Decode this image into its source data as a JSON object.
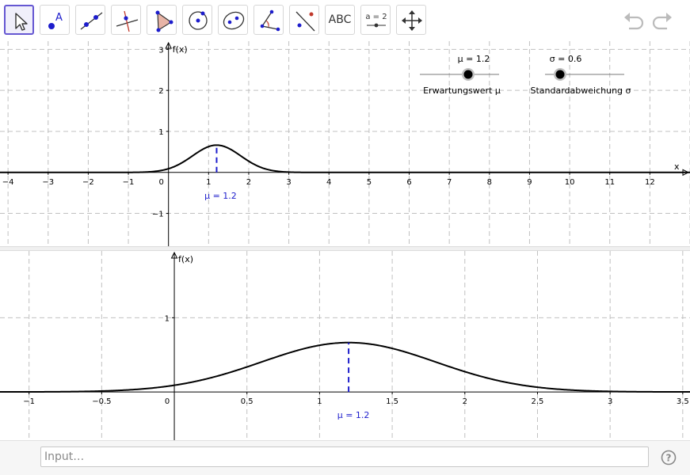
{
  "toolbar": {
    "tools": [
      {
        "name": "move-tool",
        "icon": "cursor-arrow-icon",
        "selected": true
      },
      {
        "name": "point-tool",
        "icon": "point-with-label-icon"
      },
      {
        "name": "line-tool",
        "icon": "line-through-two-points-icon"
      },
      {
        "name": "perpendicular-tool",
        "icon": "perpendicular-line-icon"
      },
      {
        "name": "polygon-tool",
        "icon": "polygon-icon"
      },
      {
        "name": "circle-tool",
        "icon": "circle-with-center-icon"
      },
      {
        "name": "conic-tool",
        "icon": "ellipse-icon"
      },
      {
        "name": "angle-tool",
        "icon": "angle-icon"
      },
      {
        "name": "reflect-tool",
        "icon": "reflect-about-line-icon"
      },
      {
        "name": "text-tool",
        "icon": "text-icon",
        "label": "ABC"
      },
      {
        "name": "slider-tool",
        "icon": "slider-icon",
        "label": "a = 2"
      },
      {
        "name": "move-graphics-view-tool",
        "icon": "move-arrows-icon"
      }
    ],
    "undo_icon": "undo-icon",
    "redo_icon": "redo-icon"
  },
  "colors": {
    "grid": "#c0c0c0",
    "axis": "#000000",
    "curve": "#000000",
    "mean_line": "#1d1dcc",
    "slider_line": "#7a7a7a",
    "slider_knob": "#000000",
    "selection": "#6557d2"
  },
  "graphics1": {
    "x_label": "x",
    "y_label": "f(x)",
    "x_ticks": [
      "−4",
      "−3",
      "−2",
      "−1",
      "0",
      "1",
      "2",
      "3",
      "4",
      "5",
      "6",
      "7",
      "8",
      "9",
      "10",
      "11",
      "12"
    ],
    "y_ticks": [
      "3",
      "2",
      "1",
      "−1"
    ],
    "mean_label": "μ = 1.2"
  },
  "graphics2": {
    "y_label": "f(x)",
    "x_ticks": [
      "−1",
      "−0.5",
      "0",
      "0.5",
      "1",
      "1.5",
      "2",
      "2.5",
      "3",
      "3.5"
    ],
    "y_ticks": [
      "1"
    ],
    "mean_label": "μ = 1.2"
  },
  "sliders": [
    {
      "name": "mu-slider",
      "value_label": "μ = 1.2",
      "caption": "Erwartungswert μ",
      "value": 1.2
    },
    {
      "name": "sigma-slider",
      "value_label": "σ = 0.6",
      "caption": "Standardabweichung σ",
      "value": 0.6
    }
  ],
  "chart_data": [
    {
      "type": "line",
      "title": "",
      "xlabel": "x",
      "ylabel": "f(x)",
      "xlim": [
        -4.2,
        13
      ],
      "ylim": [
        -1.8,
        3.2
      ],
      "grid": true,
      "function": "normal density",
      "mu": 1.2,
      "sigma": 0.6,
      "peak": [
        1.2,
        0.665
      ],
      "annotations": [
        "μ = 1.2"
      ]
    },
    {
      "type": "line",
      "title": "",
      "xlabel": "",
      "ylabel": "f(x)",
      "xlim": [
        -1.2,
        3.55
      ],
      "ylim": [
        -0.65,
        1.9
      ],
      "grid": true,
      "function": "normal density",
      "mu": 1.2,
      "sigma": 0.6,
      "peak": [
        1.2,
        0.665
      ],
      "annotations": [
        "μ = 1.2"
      ]
    }
  ],
  "input_bar": {
    "placeholder": "Input…",
    "help_icon": "help-question-icon"
  }
}
